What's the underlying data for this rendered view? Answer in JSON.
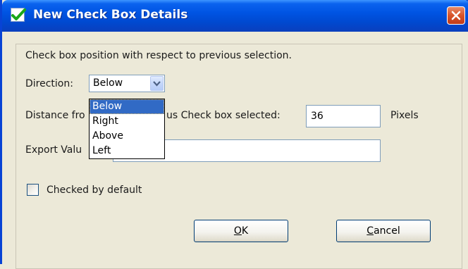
{
  "window": {
    "title": "New Check Box Details",
    "icon": "green-check-icon",
    "close_icon": "close-icon"
  },
  "form": {
    "instruction": "Check box position with respect to previous selection.",
    "direction_label": "Direction:",
    "direction_value": "Below",
    "direction_options": [
      "Below",
      "Right",
      "Above",
      "Left"
    ],
    "distance_label_left": "Distance fro",
    "distance_label_right": "us Check box selected:",
    "distance_value": "36",
    "distance_unit": "Pixels",
    "export_label": "Export Valu",
    "export_value": "",
    "checked_by_default_label": "Checked by default",
    "checked_by_default": false
  },
  "buttons": {
    "ok_mnemonic": "O",
    "ok_rest": "K",
    "cancel_mnemonic": "C",
    "cancel_rest": "ancel"
  },
  "colors": {
    "titlebar": "#0054e3",
    "selection": "#316ac5",
    "close_button": "#d8542a"
  }
}
